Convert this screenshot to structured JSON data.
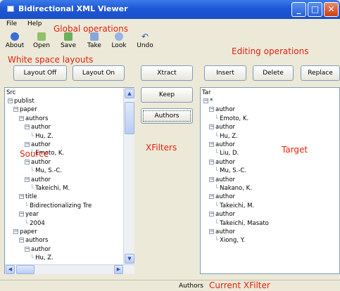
{
  "window": {
    "title": "Bidirectional XML Viewer",
    "minimize": "_",
    "maximize": "□",
    "close": "✕"
  },
  "menu": {
    "file": "File",
    "help": "Help"
  },
  "toolbar": [
    {
      "label": "About",
      "icon": "info-icon"
    },
    {
      "label": "Open",
      "icon": "open-icon"
    },
    {
      "label": "Save",
      "icon": "save-icon"
    },
    {
      "label": "Take",
      "icon": "take-icon"
    },
    {
      "label": "Look",
      "icon": "look-icon"
    },
    {
      "label": "Undo",
      "icon": "undo-icon"
    }
  ],
  "buttons": {
    "layout_off": "Layout Off",
    "layout_on": "Layout On",
    "xtract": "Xtract",
    "insert": "Insert",
    "delete": "Delete",
    "replace": "Replace",
    "keep": "Keep",
    "authors": "Authors"
  },
  "annotations": {
    "global_operations": "Global operations",
    "editing_operations": "Editing operations",
    "white_space_layouts": "White space layouts",
    "source": "Source",
    "xfilters": "XFilters",
    "target": "Target",
    "current_xfilter": "Current XFilter"
  },
  "source_panel": {
    "header": "Src",
    "lines": [
      {
        "text": "publist",
        "expander": "−"
      },
      {
        "text": "paper",
        "expander": "−"
      },
      {
        "text": "authors",
        "expander": "−"
      },
      {
        "text": "author",
        "expander": "−"
      },
      {
        "text": "Hu, Z.",
        "expander": ""
      },
      {
        "text": "author",
        "expander": "−"
      },
      {
        "text": "Emoto, K.",
        "expander": ""
      },
      {
        "text": "author",
        "expander": "−"
      },
      {
        "text": "Mu, S.-C.",
        "expander": ""
      },
      {
        "text": "author",
        "expander": "−"
      },
      {
        "text": "Takeichi, M.",
        "expander": ""
      },
      {
        "text": "title",
        "expander": "−"
      },
      {
        "text": "Bidirectionalizing Tre",
        "expander": ""
      },
      {
        "text": "year",
        "expander": "−"
      },
      {
        "text": "2004",
        "expander": ""
      },
      {
        "text": "paper",
        "expander": "−"
      },
      {
        "text": "authors",
        "expander": "−"
      },
      {
        "text": "author",
        "expander": "−"
      },
      {
        "text": "Hu, Z.",
        "expander": ""
      }
    ]
  },
  "target_panel": {
    "header": "Tar",
    "lines": [
      {
        "text": "*",
        "expander": "−"
      },
      {
        "text": "author",
        "expander": "−"
      },
      {
        "text": "Emoto, K.",
        "expander": ""
      },
      {
        "text": "author",
        "expander": "−"
      },
      {
        "text": "Hu, Z.",
        "expander": ""
      },
      {
        "text": "author",
        "expander": "−"
      },
      {
        "text": "Liu, D.",
        "expander": ""
      },
      {
        "text": "author",
        "expander": "−"
      },
      {
        "text": "Mu, S.-C.",
        "expander": ""
      },
      {
        "text": "author",
        "expander": "−"
      },
      {
        "text": "Nakano, K.",
        "expander": ""
      },
      {
        "text": "author",
        "expander": "−"
      },
      {
        "text": "Takeichi, M.",
        "expander": ""
      },
      {
        "text": "author",
        "expander": "−"
      },
      {
        "text": "Takeichi, Masato",
        "expander": ""
      },
      {
        "text": "author",
        "expander": "−"
      },
      {
        "text": "Xiong, Y.",
        "expander": ""
      }
    ]
  },
  "status": {
    "current_filter": "Authors"
  },
  "colors": {
    "annotation": "#e8210e",
    "titlebar": "#1f57d6",
    "background": "#ece9d8"
  }
}
